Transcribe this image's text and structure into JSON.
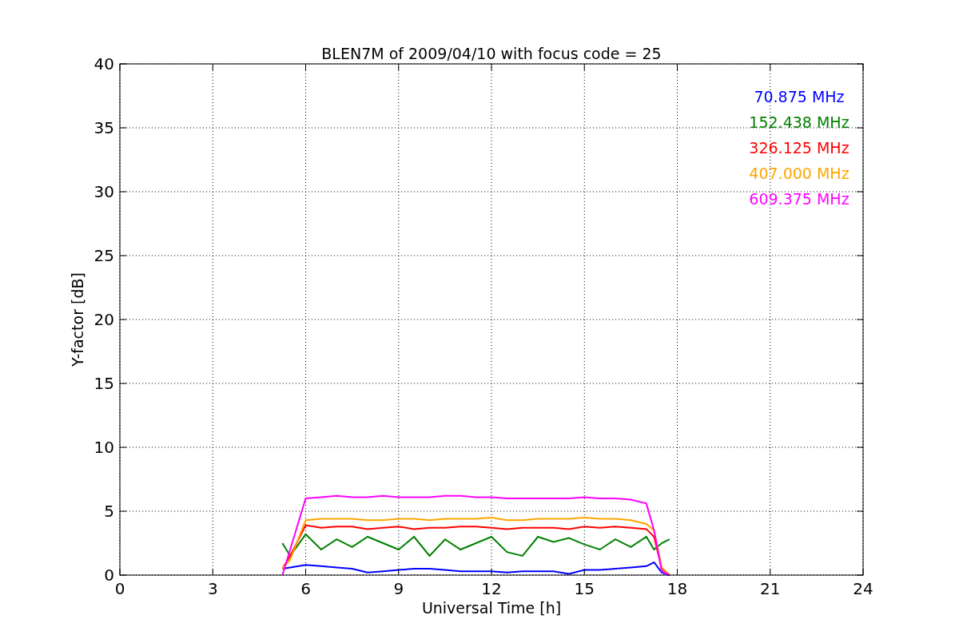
{
  "chart_data": {
    "type": "line",
    "title": "BLEN7M of 2009/04/10 with focus code = 25",
    "xlabel": "Universal Time [h]",
    "ylabel": "Y-factor [dB]",
    "x": [
      5.25,
      5.5,
      6,
      6.5,
      7,
      7.5,
      8,
      8.5,
      9,
      9.5,
      10,
      10.5,
      11,
      11.5,
      12,
      12.5,
      13,
      13.5,
      14,
      14.5,
      15,
      15.5,
      16,
      16.5,
      17,
      17.25,
      17.5,
      17.75
    ],
    "series": [
      {
        "name": "70.875 MHz",
        "color": "#0000ff",
        "values": [
          0.5,
          0.6,
          0.8,
          0.7,
          0.6,
          0.5,
          0.2,
          0.3,
          0.4,
          0.5,
          0.5,
          0.4,
          0.3,
          0.3,
          0.3,
          0.2,
          0.3,
          0.3,
          0.3,
          0.1,
          0.4,
          0.4,
          0.5,
          0.6,
          0.7,
          1.0,
          0.2,
          0
        ]
      },
      {
        "name": "152.438 MHz",
        "color": "#008000",
        "values": [
          2.5,
          1.5,
          3.2,
          2.0,
          2.8,
          2.2,
          3.0,
          2.5,
          2.0,
          3.0,
          1.5,
          2.8,
          2.0,
          2.5,
          3.0,
          1.8,
          1.5,
          3.0,
          2.6,
          2.9,
          2.4,
          2.0,
          2.8,
          2.2,
          3.0,
          2.0,
          2.5,
          2.8
        ]
      },
      {
        "name": "326.125 MHz",
        "color": "#ff0000",
        "values": [
          0.5,
          1.5,
          3.9,
          3.7,
          3.8,
          3.8,
          3.6,
          3.7,
          3.8,
          3.6,
          3.7,
          3.7,
          3.8,
          3.8,
          3.7,
          3.6,
          3.7,
          3.7,
          3.7,
          3.6,
          3.8,
          3.7,
          3.8,
          3.7,
          3.6,
          3.0,
          0.5,
          0
        ]
      },
      {
        "name": "407.000 MHz",
        "color": "#ffa500",
        "values": [
          0.5,
          1.2,
          4.3,
          4.4,
          4.4,
          4.4,
          4.3,
          4.3,
          4.4,
          4.4,
          4.3,
          4.4,
          4.4,
          4.4,
          4.5,
          4.3,
          4.3,
          4.4,
          4.4,
          4.4,
          4.5,
          4.4,
          4.4,
          4.3,
          4.0,
          3.5,
          0.6,
          0
        ]
      },
      {
        "name": "609.375 MHz",
        "color": "#ff00ff",
        "values": [
          0,
          2.0,
          6.0,
          6.1,
          6.2,
          6.1,
          6.1,
          6.2,
          6.1,
          6.1,
          6.1,
          6.2,
          6.2,
          6.1,
          6.1,
          6.0,
          6.0,
          6.0,
          6.0,
          6.0,
          6.1,
          6.0,
          6.0,
          5.9,
          5.6,
          3.5,
          0.3,
          0
        ]
      }
    ],
    "grid": true,
    "xlim": [
      0,
      24
    ],
    "ylim": [
      0,
      40
    ],
    "xticks": [
      0,
      3,
      6,
      9,
      12,
      15,
      18,
      21,
      24
    ],
    "yticks": [
      0,
      5,
      10,
      15,
      20,
      25,
      30,
      35,
      40
    ]
  }
}
